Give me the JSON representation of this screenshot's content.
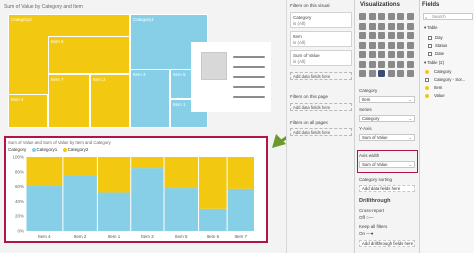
{
  "treemap": {
    "title": "Sum of Value by Category and Item",
    "cells": [
      {
        "label": "Category2"
      },
      {
        "label": "Category1"
      },
      {
        "label": "Item 4"
      },
      {
        "label": "Item 7"
      },
      {
        "label": "Item 2"
      },
      {
        "label": "Item 3"
      },
      {
        "label": "Item 5"
      },
      {
        "label": "Item 1"
      },
      {
        "label": "Item 6"
      }
    ]
  },
  "filters": {
    "this_visual_heading": "Filters on this visual",
    "cards": [
      {
        "title": "Category",
        "state": "is (All)"
      },
      {
        "title": "Item",
        "state": "is (All)"
      },
      {
        "title": "Sum of Value",
        "state": "is (All)"
      }
    ],
    "add_label": "Add data fields here",
    "this_page_heading": "Filters on this page",
    "all_pages_heading": "Filters on all pages"
  },
  "visualizations": {
    "title": "Visualizations",
    "wells": [
      {
        "label": "Category",
        "value": "Item"
      },
      {
        "label": "Series",
        "value": "Category"
      },
      {
        "label": "Y-Axis",
        "value": "Sum of Value"
      },
      {
        "label": "Axis width",
        "value": "Sum of Value"
      }
    ],
    "category_sorting": "Category sorting",
    "add_label": "Add data fields here",
    "drillthrough": "Drillthrough",
    "cross_report": "Cross-report",
    "cross_report_state": "Off",
    "keep_filters": "Keep all filters",
    "keep_filters_state": "On",
    "add_drillthrough": "Add drillthrough fields here"
  },
  "fields": {
    "title": "Fields",
    "search_placeholder": "Search",
    "items": [
      {
        "label": "Table"
      },
      {
        "label": "Day"
      },
      {
        "label": "Status"
      },
      {
        "label": "Date"
      },
      {
        "label": "Table (2)"
      },
      {
        "label": "Category"
      },
      {
        "label": "Category - Sor..."
      },
      {
        "label": "Item"
      },
      {
        "label": "Value"
      }
    ]
  },
  "chart": {
    "title": "Sum of Value and Sum of Value by Item and Category",
    "legend_title": "Category",
    "legend_items": [
      "Category1",
      "Category2"
    ]
  },
  "colors": {
    "category1": "#86cfe6",
    "category2": "#f2c811",
    "accent": "#b4124f",
    "arrow": "#6b9a2b"
  },
  "chart_data": {
    "type": "bar",
    "subtype": "100% stacked variable-width (Mekko)",
    "categories": [
      "Item 4",
      "Item 2",
      "Item 1",
      "Item 3",
      "Item 5",
      "Item 6",
      "Item 7"
    ],
    "series": [
      {
        "name": "Category1",
        "values": [
          0.62,
          0.75,
          0.52,
          0.85,
          0.58,
          0.3,
          0.57
        ]
      },
      {
        "name": "Category2",
        "values": [
          0.38,
          0.25,
          0.48,
          0.15,
          0.42,
          0.7,
          0.43
        ]
      }
    ],
    "axis_width_share": [
      0.155,
      0.145,
      0.14,
      0.14,
      0.145,
      0.12,
      0.115
    ],
    "ylim": [
      0,
      1
    ],
    "y_ticks": [
      "0%",
      "20%",
      "40%",
      "60%",
      "80%",
      "100%"
    ]
  }
}
